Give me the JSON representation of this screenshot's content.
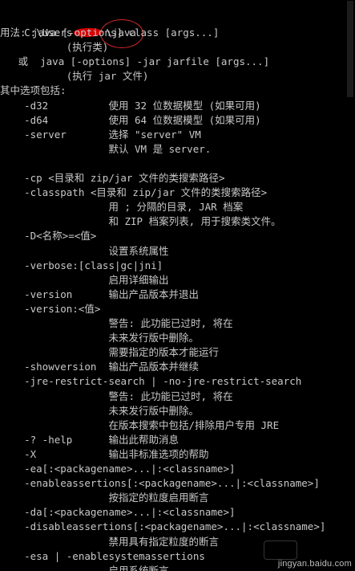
{
  "console": {
    "prompt": {
      "path_start": "C:\\Users",
      "path_end": "",
      "separator": "\\",
      "command": "java"
    },
    "lines": [
      "用法: java [-options] class [args...]",
      "           (执行类)",
      "   或  java [-options] -jar jarfile [args...]",
      "           (执行 jar 文件)",
      "其中选项包括:",
      "    -d32          使用 32 位数据模型 (如果可用)",
      "    -d64          使用 64 位数据模型 (如果可用)",
      "    -server       选择 \"server\" VM",
      "                  默认 VM 是 server.",
      "",
      "    -cp <目录和 zip/jar 文件的类搜索路径>",
      "    -classpath <目录和 zip/jar 文件的类搜索路径>",
      "                  用 ; 分隔的目录, JAR 档案",
      "                  和 ZIP 档案列表, 用于搜索类文件。",
      "    -D<名称>=<值>",
      "                  设置系统属性",
      "    -verbose:[class|gc|jni]",
      "                  启用详细输出",
      "    -version      输出产品版本并退出",
      "    -version:<值>",
      "                  警告: 此功能已过时, 将在",
      "                  未来发行版中删除。",
      "                  需要指定的版本才能运行",
      "    -showversion  输出产品版本并继续",
      "    -jre-restrict-search | -no-jre-restrict-search",
      "                  警告: 此功能已过时, 将在",
      "                  未来发行版中删除。",
      "                  在版本搜索中包括/排除用户专用 JRE",
      "    -? -help      输出此帮助消息",
      "    -X            输出非标准选项的帮助",
      "    -ea[:<packagename>...|:<classname>]",
      "    -enableassertions[:<packagename>...|:<classname>]",
      "                  按指定的粒度启用断言",
      "    -da[:<packagename>...|:<classname>]",
      "    -disableassertions[:<packagename>...|:<classname>]",
      "                  禁用具有指定粒度的断言",
      "    -esa | -enablesystemassertions",
      "                  启用系统断言"
    ]
  },
  "watermark": {
    "text": "jingyan.baidu.com"
  },
  "colors": {
    "background": "#000000",
    "text": "#c8c8c8",
    "annotation_red": "#d42a2a",
    "redaction_red": "#d50000"
  }
}
